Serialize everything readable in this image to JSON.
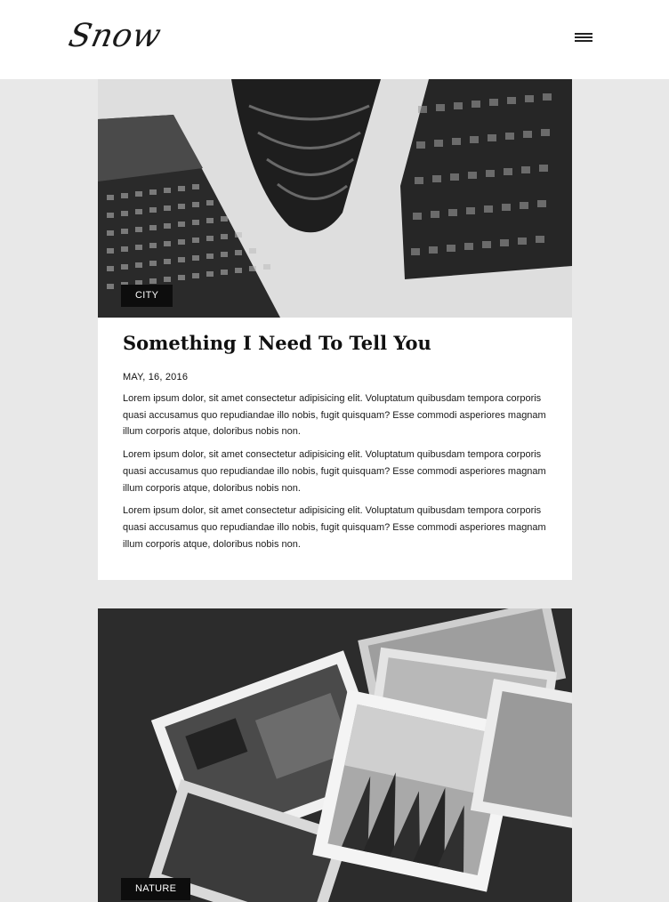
{
  "header": {
    "logo_text": "Snow",
    "menu_icon": "hamburger-menu-icon"
  },
  "posts": [
    {
      "category": "CITY",
      "title": "Something I Need To Tell You",
      "date": "MAY, 16, 2016",
      "paragraphs": [
        "Lorem ipsum dolor, sit amet consectetur adipisicing elit. Voluptatum quibusdam tempora corporis quasi accusamus quo repudiandae illo nobis, fugit quisquam? Esse commodi asperiores magnam illum corporis atque, doloribus nobis non.",
        "Lorem ipsum dolor, sit amet consectetur adipisicing elit. Voluptatum quibusdam tempora corporis quasi accusamus quo repudiandae illo nobis, fugit quisquam? Esse commodi asperiores magnam illum corporis atque, doloribus nobis non.",
        "Lorem ipsum dolor, sit amet consectetur adipisicing elit. Voluptatum quibusdam tempora corporis quasi accusamus quo repudiandae illo nobis, fugit quisquam? Esse commodi asperiores magnam illum corporis atque, doloribus nobis non."
      ]
    },
    {
      "category": "NATURE"
    }
  ],
  "colors": {
    "page_background": "#e8e8e8",
    "card_background": "#ffffff",
    "tag_background": "#0d0d0d",
    "tag_text": "#ffffff"
  }
}
